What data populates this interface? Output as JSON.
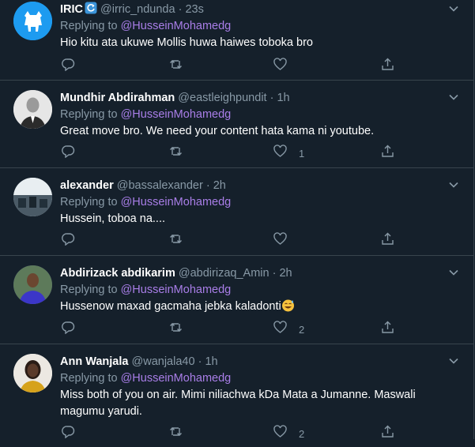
{
  "colors": {
    "background": "#15202b",
    "divider": "#38444d",
    "muted": "#8899a6",
    "mention": "#a97ee8"
  },
  "reply_prefix": "Replying to",
  "tweets": [
    {
      "name": "IRIC",
      "handle": "@irric_ndunda",
      "time": "23s",
      "mention": "@HusseinMohamedg",
      "text": "Hio kitu ata ukuwe Mollis huwa haiwes toboka bro",
      "reply_count": "",
      "like_count": ""
    },
    {
      "name": "Mundhir Abdirahman",
      "handle": "@eastleighpundit",
      "time": "1h",
      "mention": "@HusseinMohamedg",
      "text": "Great move bro. We need your content hata kama ni youtube.",
      "reply_count": "",
      "like_count": "1"
    },
    {
      "name": "alexander",
      "handle": "@bassalexander",
      "time": "2h",
      "mention": "@HusseinMohamedg",
      "text": "Hussein, toboa na....",
      "reply_count": "",
      "like_count": ""
    },
    {
      "name": "Abdirizack abdikarim",
      "handle": "@abdirizaq_Amin",
      "time": "2h",
      "mention": "@HusseinMohamedg",
      "text": "Hussenow maxad gacmaha jebka kaladonti",
      "reply_count": "",
      "like_count": "2"
    },
    {
      "name": "Ann Wanjala",
      "handle": "@wanjala40",
      "time": "1h",
      "mention": "@HusseinMohamedg",
      "text": "Miss both of you on air. Mimi niliachwa kDa Mata a Jumanne. Maswali magumu yarudi.",
      "reply_count": "",
      "like_count": "2"
    }
  ],
  "icons": {
    "caret": "chevron-down-icon",
    "reply": "reply-icon",
    "retweet": "retweet-icon",
    "like": "heart-icon",
    "share": "share-icon",
    "verified": "verified-badge-icon",
    "emoji": "sweat-smile-emoji"
  }
}
